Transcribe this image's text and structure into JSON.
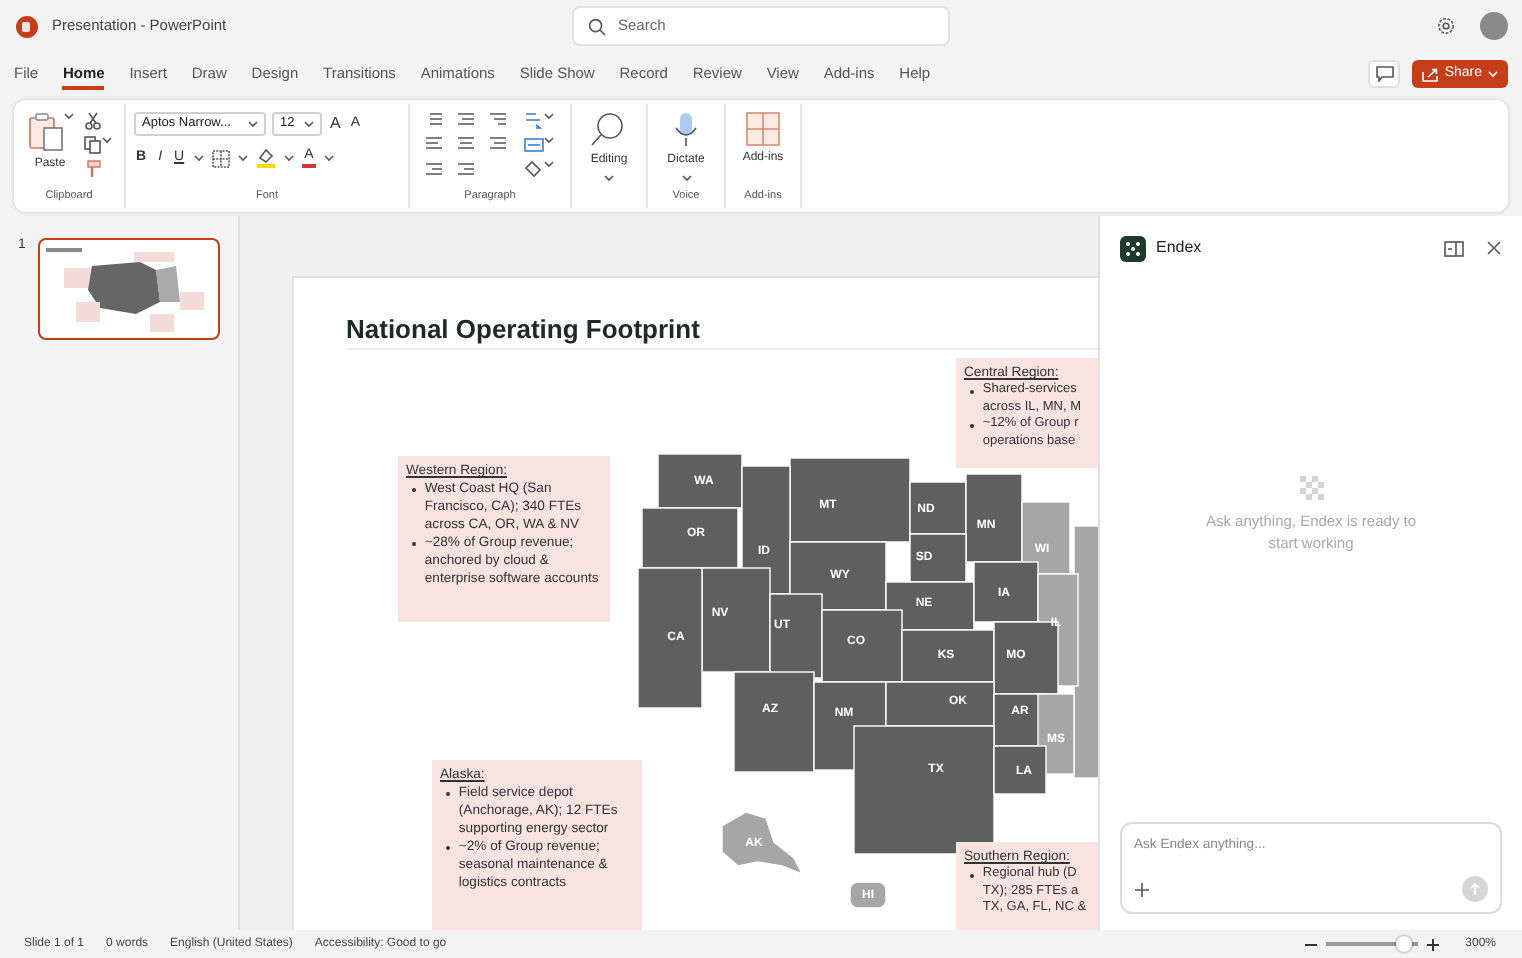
{
  "window": {
    "title": "Presentation - PowerPoint"
  },
  "search": {
    "placeholder": "Search"
  },
  "tabs": [
    {
      "label": "File",
      "selected": false
    },
    {
      "label": "Home",
      "selected": true
    },
    {
      "label": "Insert",
      "selected": false
    },
    {
      "label": "Draw",
      "selected": false
    },
    {
      "label": "Design",
      "selected": false
    },
    {
      "label": "Transitions",
      "selected": false
    },
    {
      "label": "Animations",
      "selected": false
    },
    {
      "label": "Slide Show",
      "selected": false
    },
    {
      "label": "Record",
      "selected": false
    },
    {
      "label": "Review",
      "selected": false
    },
    {
      "label": "View",
      "selected": false
    },
    {
      "label": "Add-ins",
      "selected": false
    },
    {
      "label": "Help",
      "selected": false
    }
  ],
  "share_button": {
    "label": "Share"
  },
  "ribbon": [
    {
      "kind": "clipboard",
      "label": "Clipboard",
      "button": "Paste"
    },
    {
      "kind": "font",
      "label": "Font",
      "font_name": "Aptos Narrow...",
      "font_size": "12",
      "size_buttons": [
        "A",
        "A"
      ],
      "styles": [
        "B",
        "I",
        "U"
      ],
      "color_button": "A"
    },
    {
      "kind": "paragraph",
      "label": "Paragraph"
    },
    {
      "kind": "editing",
      "button": "Editing"
    },
    {
      "kind": "voice",
      "label": "Voice",
      "button": "Dictate"
    },
    {
      "kind": "addins",
      "label": "Add-ins",
      "button": "Add-ins"
    }
  ],
  "slides": [
    {
      "number": "1",
      "selected": true
    }
  ],
  "slide": {
    "title": "National Operating Footprint",
    "callouts": [
      {
        "heading": "Central Region:",
        "bullets": [
          "Shared-services\nacross IL, MN, M",
          "~12% of Group r\noperations base"
        ]
      },
      {
        "heading": "Western Region:",
        "bullets": [
          "West Coast HQ (San Francisco, CA); 340 FTEs across CA, OR, WA & NV",
          "~28% of Group revenue; anchored by cloud & enterprise software accounts"
        ]
      },
      {
        "heading": "Alaska:",
        "bullets": [
          "Field service depot (Anchorage, AK); 12 FTEs supporting energy sector",
          "~2% of Group revenue; seasonal maintenance & logistics contracts"
        ]
      },
      {
        "heading": "Southern Region:",
        "bullets": [
          "Regional hub (D\nTX); 285 FTEs a\nTX, GA, FL, NC &"
        ]
      }
    ],
    "map": {
      "states": [
        {
          "label": "WA",
          "highlighted": false
        },
        {
          "label": "MT",
          "highlighted": false
        },
        {
          "label": "ND",
          "highlighted": false
        },
        {
          "label": "MN",
          "highlighted": false
        },
        {
          "label": "WI",
          "highlighted": true
        },
        {
          "label": "OR",
          "highlighted": false
        },
        {
          "label": "ID",
          "highlighted": false
        },
        {
          "label": "SD",
          "highlighted": false
        },
        {
          "label": "WY",
          "highlighted": false
        },
        {
          "label": "NV",
          "highlighted": false
        },
        {
          "label": "UT",
          "highlighted": false
        },
        {
          "label": "NE",
          "highlighted": false
        },
        {
          "label": "IA",
          "highlighted": false
        },
        {
          "label": "CA",
          "highlighted": false
        },
        {
          "label": "CO",
          "highlighted": false
        },
        {
          "label": "IL",
          "highlighted": true
        },
        {
          "label": "KS",
          "highlighted": false
        },
        {
          "label": "MO",
          "highlighted": false
        },
        {
          "label": "AZ",
          "highlighted": false
        },
        {
          "label": "NM",
          "highlighted": false
        },
        {
          "label": "OK",
          "highlighted": false
        },
        {
          "label": "AR",
          "highlighted": false
        },
        {
          "label": "MS",
          "highlighted": true
        },
        {
          "label": "TX",
          "highlighted": false
        },
        {
          "label": "LA",
          "highlighted": false
        },
        {
          "label": "AK",
          "highlighted": true
        },
        {
          "label": "HI",
          "highlighted": true
        }
      ]
    }
  },
  "assistant": {
    "name": "Endex",
    "message": "Ask anything, Endex is ready to start working",
    "input": {
      "placeholder": "Ask Endex anything..."
    }
  },
  "status_bar": {
    "items": [
      "Slide 1 of 1",
      "0 words",
      "English (United States)",
      "Accessibility: Good to go"
    ],
    "zoom": {
      "level": 0.85,
      "reading": "300%"
    }
  }
}
